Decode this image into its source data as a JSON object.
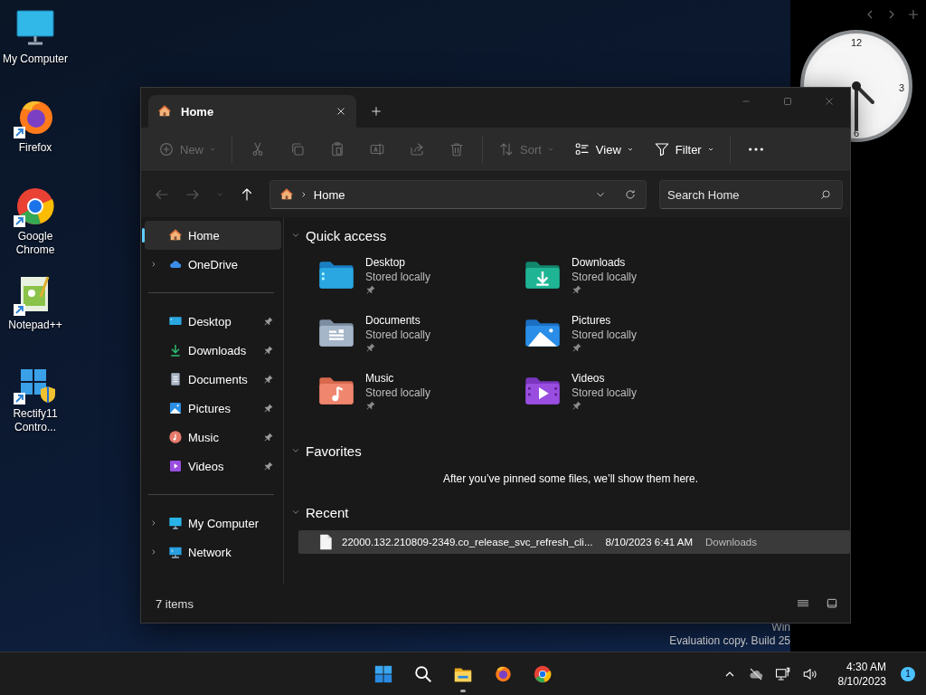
{
  "desktop_icons": [
    {
      "label": "My Computer",
      "kind": "computer",
      "shortcut": false
    },
    {
      "label": "Firefox",
      "kind": "firefox",
      "shortcut": true
    },
    {
      "label": "Google Chrome",
      "kind": "chrome",
      "shortcut": true
    },
    {
      "label": "Notepad++",
      "kind": "notepad",
      "shortcut": true
    },
    {
      "label": "Rectify11 Contro...",
      "kind": "rectify",
      "shortcut": true
    }
  ],
  "clock_widget": {
    "numerals": [
      "12",
      "3",
      "6"
    ]
  },
  "watermark": [
    "Win",
    "Evaluation copy. Build 25"
  ],
  "window": {
    "tabs": [
      {
        "title": "Home",
        "selected": true
      }
    ],
    "toolbar": [
      {
        "kind": "new",
        "label": "New",
        "disabled": true,
        "dropdown": true
      },
      {
        "kind": "cut",
        "disabled": true
      },
      {
        "kind": "copy",
        "disabled": true
      },
      {
        "kind": "paste",
        "disabled": true
      },
      {
        "kind": "rename",
        "disabled": true
      },
      {
        "kind": "share",
        "disabled": true
      },
      {
        "kind": "delete",
        "disabled": true
      },
      {
        "kind": "sort",
        "label": "Sort",
        "disabled": true,
        "dropdown": true
      },
      {
        "kind": "view",
        "label": "View",
        "disabled": false,
        "dropdown": true
      },
      {
        "kind": "filter",
        "label": "Filter",
        "disabled": false,
        "dropdown": true
      },
      {
        "kind": "more",
        "disabled": false
      }
    ],
    "nav": [
      {
        "kind": "back",
        "disabled": true
      },
      {
        "kind": "forward",
        "disabled": true
      },
      {
        "kind": "recent",
        "disabled": true
      },
      {
        "kind": "up",
        "disabled": false
      }
    ],
    "address": {
      "path": "Home"
    },
    "search": {
      "placeholder": "Search Home"
    },
    "sidebar": [
      [
        {
          "label": "Home",
          "kind": "home",
          "selected": true,
          "expandable": false,
          "pinned": false
        },
        {
          "label": "OneDrive",
          "kind": "cloud",
          "selected": false,
          "expandable": true,
          "pinned": false
        }
      ],
      [
        {
          "label": "Desktop",
          "kind": "desktop",
          "selected": false,
          "expandable": false,
          "pinned": true
        },
        {
          "label": "Downloads",
          "kind": "downloads",
          "selected": false,
          "expandable": false,
          "pinned": true
        },
        {
          "label": "Documents",
          "kind": "documents",
          "selected": false,
          "expandable": false,
          "pinned": true
        },
        {
          "label": "Pictures",
          "kind": "pictures",
          "selected": false,
          "expandable": false,
          "pinned": true
        },
        {
          "label": "Music",
          "kind": "music",
          "selected": false,
          "expandable": false,
          "pinned": true
        },
        {
          "label": "Videos",
          "kind": "videos",
          "selected": false,
          "expandable": false,
          "pinned": true
        }
      ],
      [
        {
          "label": "My Computer",
          "kind": "computer",
          "selected": false,
          "expandable": true,
          "pinned": false
        },
        {
          "label": "Network",
          "kind": "network",
          "selected": false,
          "expandable": true,
          "pinned": false
        }
      ]
    ],
    "quick_access": {
      "title": "Quick access",
      "expanded": true,
      "items": [
        {
          "name": "Desktop",
          "status": "Stored locally",
          "kind": "desktop",
          "pinned": true
        },
        {
          "name": "Downloads",
          "status": "Stored locally",
          "kind": "downloads",
          "pinned": true
        },
        {
          "name": "Documents",
          "status": "Stored locally",
          "kind": "documents",
          "pinned": true
        },
        {
          "name": "Pictures",
          "status": "Stored locally",
          "kind": "pictures",
          "pinned": true
        },
        {
          "name": "Music",
          "status": "Stored locally",
          "kind": "music",
          "pinned": true
        },
        {
          "name": "Videos",
          "status": "Stored locally",
          "kind": "videos",
          "pinned": true
        }
      ]
    },
    "favorites": {
      "title": "Favorites",
      "expanded": true,
      "empty_message": "After you’ve pinned some files, we’ll show them here."
    },
    "recent": {
      "title": "Recent",
      "expanded": true,
      "files": [
        {
          "name": "22000.132.210809-2349.co_release_svc_refresh_cli...",
          "date": "8/10/2023 6:41 AM",
          "location": "Downloads",
          "highlighted": true
        }
      ]
    },
    "status_bar": {
      "count": "7 items"
    }
  },
  "taskbar": {
    "apps": [
      {
        "kind": "start",
        "running": false
      },
      {
        "kind": "search",
        "running": false
      },
      {
        "kind": "explorer",
        "running": true
      },
      {
        "kind": "firefox",
        "running": false
      },
      {
        "kind": "chrome",
        "running": false
      }
    ],
    "time": "4:30 AM",
    "date": "8/10/2023",
    "notifications": "1"
  }
}
